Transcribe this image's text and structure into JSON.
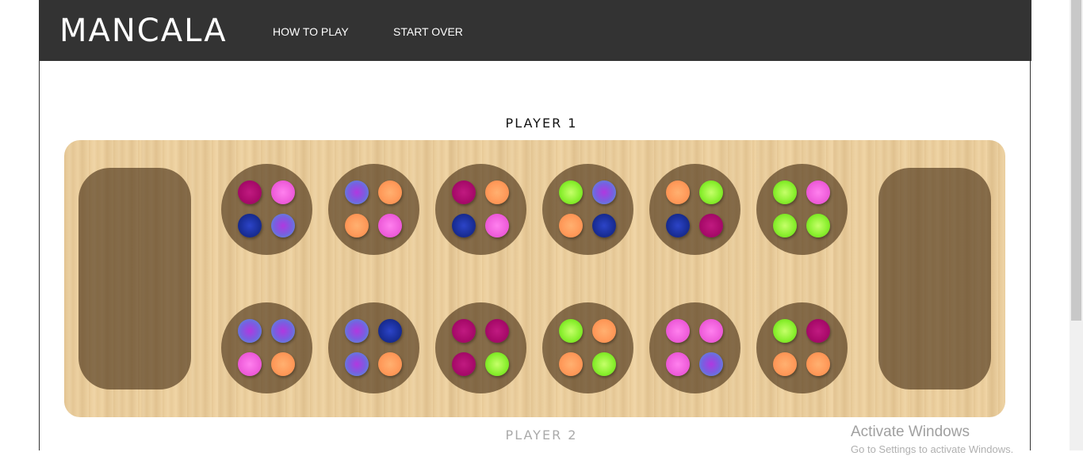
{
  "header": {
    "logo": "MANCALA",
    "nav": [
      {
        "label": "HOW TO PLAY"
      },
      {
        "label": "START OVER"
      }
    ]
  },
  "player1": {
    "label": "PLAYER 1"
  },
  "player2": {
    "label": "PLAYER 2"
  },
  "board": {
    "top_row": [
      [
        "magenta",
        "pink",
        "navy",
        "purple-blue"
      ],
      [
        "purple-blue",
        "orange",
        "orange",
        "pink"
      ],
      [
        "magenta",
        "orange",
        "navy",
        "pink"
      ],
      [
        "green",
        "purple-blue",
        "orange",
        "navy"
      ],
      [
        "orange",
        "green",
        "navy",
        "magenta"
      ],
      [
        "green",
        "pink",
        "green",
        "green"
      ]
    ],
    "bottom_row": [
      [
        "purple-blue",
        "purple-blue",
        "pink",
        "orange"
      ],
      [
        "purple-blue",
        "navy",
        "purple-blue",
        "orange"
      ],
      [
        "magenta",
        "magenta",
        "magenta",
        "green"
      ],
      [
        "green",
        "orange",
        "orange",
        "green"
      ],
      [
        "pink",
        "pink",
        "pink",
        "purple-blue"
      ],
      [
        "green",
        "magenta",
        "orange",
        "orange"
      ]
    ]
  },
  "watermark": {
    "title": "Activate Windows",
    "subtitle": "Go to Settings to activate Windows."
  }
}
